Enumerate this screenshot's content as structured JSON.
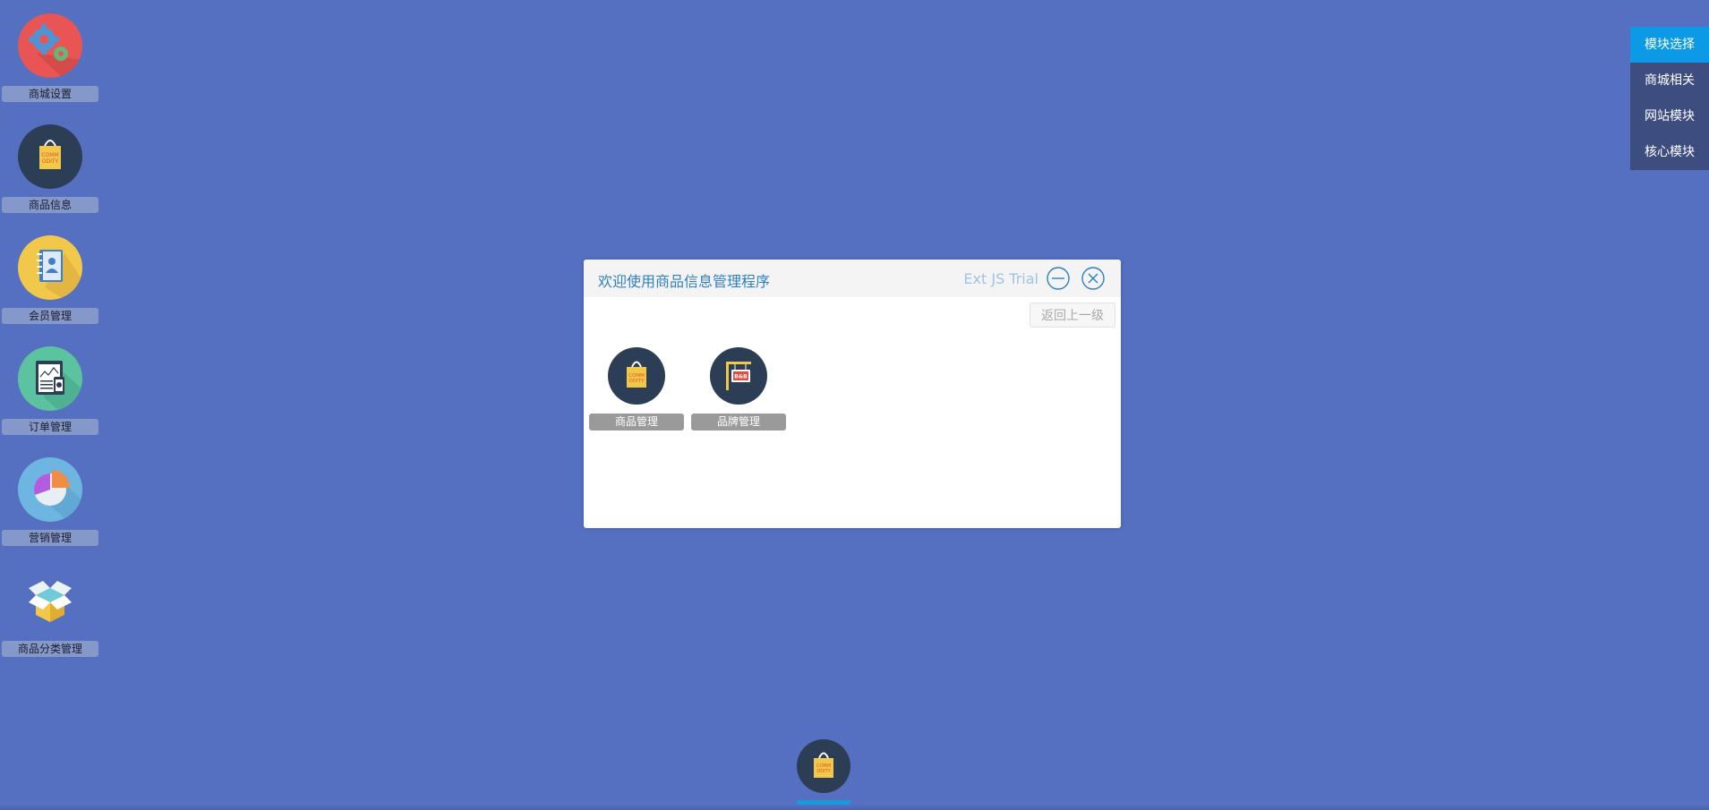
{
  "desktop": {
    "icons": [
      {
        "label": "商城设置",
        "icon": "gears-icon"
      },
      {
        "label": "商品信息",
        "icon": "commodity-bag-icon"
      },
      {
        "label": "会员管理",
        "icon": "contacts-book-icon"
      },
      {
        "label": "订单管理",
        "icon": "order-clipboard-icon"
      },
      {
        "label": "营销管理",
        "icon": "pie-chart-icon"
      },
      {
        "label": "商品分类管理",
        "icon": "open-box-icon"
      }
    ]
  },
  "module_menu": {
    "items": [
      {
        "label": "模块选择",
        "active": true
      },
      {
        "label": "商城相关",
        "active": false
      },
      {
        "label": "网站模块",
        "active": false
      },
      {
        "label": "核心模块",
        "active": false
      }
    ]
  },
  "window": {
    "title": "欢迎使用商品信息管理程序",
    "trial_text": "Ext JS Trial",
    "back_button": "返回上一级",
    "apps": [
      {
        "label": "商品管理",
        "icon": "commodity-bag-icon"
      },
      {
        "label": "品牌管理",
        "icon": "brand-signboard-icon"
      }
    ],
    "bag_text": "COMM ODITY",
    "sign_text": "B&B"
  },
  "taskbar": {
    "task_icon": "commodity-bag-icon"
  },
  "colors": {
    "desktop_bg": "#5570c0",
    "accent": "#0c9ae6",
    "title": "#2f7fc4"
  }
}
